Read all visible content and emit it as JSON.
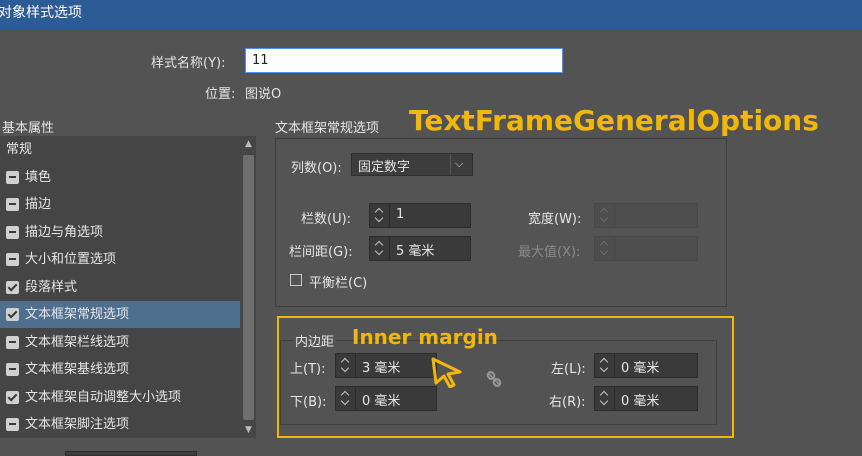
{
  "window": {
    "title": "对象样式选项"
  },
  "style_name": {
    "label": "样式名称(Y):",
    "value": "11"
  },
  "location": {
    "label": "位置:",
    "value": "图说O"
  },
  "sidebar": {
    "header": "基本属性",
    "items": [
      {
        "label": "常规",
        "state": "none"
      },
      {
        "label": "填色",
        "state": "mixed"
      },
      {
        "label": "描边",
        "state": "mixed"
      },
      {
        "label": "描边与角选项",
        "state": "mixed"
      },
      {
        "label": "大小和位置选项",
        "state": "mixed"
      },
      {
        "label": "段落样式",
        "state": "checked"
      },
      {
        "label": "文本框架常规选项",
        "state": "checked",
        "selected": true
      },
      {
        "label": "文本框架栏线选项",
        "state": "mixed"
      },
      {
        "label": "文本框架基线选项",
        "state": "mixed"
      },
      {
        "label": "文本框架自动调整大小选项",
        "state": "checked"
      },
      {
        "label": "文本框架脚注选项",
        "state": "mixed"
      }
    ]
  },
  "main": {
    "section_title": "文本框架常规选项",
    "annotation_main": "TextFrameGeneralOptions",
    "columns": {
      "label": "列数(O):",
      "value": "固定数字"
    },
    "column_count": {
      "label": "栏数(U):",
      "value": "1"
    },
    "width": {
      "label": "宽度(W):",
      "value": ""
    },
    "gutter": {
      "label": "栏间距(G):",
      "value": "5 毫米"
    },
    "max_value": {
      "label": "最大值(X):",
      "value": ""
    },
    "balance_columns": {
      "label": "平衡栏(C)",
      "checked": false
    },
    "inset": {
      "title": "内边距",
      "annotation": "Inner margin",
      "top": {
        "label": "上(T):",
        "value": "3 毫米"
      },
      "bottom": {
        "label": "下(B):",
        "value": "0 毫米"
      },
      "left": {
        "label": "左(L):",
        "value": "0 毫米"
      },
      "right": {
        "label": "右(R):",
        "value": "0 毫米"
      }
    }
  },
  "colors": {
    "titlebar": "#2d5b96",
    "annotation": "#f1b80b",
    "selection": "#4f6f8f"
  }
}
